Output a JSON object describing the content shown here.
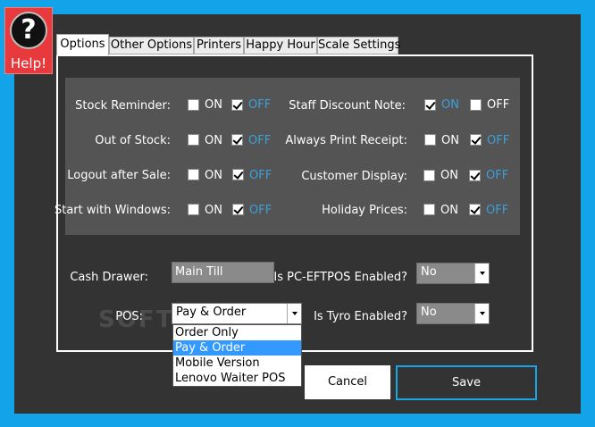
{
  "help": {
    "icon_glyph": "?",
    "label": "Help!"
  },
  "tabs": [
    {
      "label": "Options",
      "active": true
    },
    {
      "label": "Other Options"
    },
    {
      "label": "Printers"
    },
    {
      "label": "Happy Hour"
    },
    {
      "label": "Scale Settings"
    }
  ],
  "options_left": [
    {
      "label": "Stock Reminder:",
      "on": "ON",
      "off": "OFF",
      "checked": "off"
    },
    {
      "label": "Out of Stock:",
      "on": "ON",
      "off": "OFF",
      "checked": "off"
    },
    {
      "label": "Logout after Sale:",
      "on": "ON",
      "off": "OFF",
      "checked": "off"
    },
    {
      "label": "Start with Windows:",
      "on": "ON",
      "off": "OFF",
      "checked": "off"
    }
  ],
  "options_right": [
    {
      "label": "Staff Discount Note:",
      "on": "ON",
      "off": "OFF",
      "checked": "on"
    },
    {
      "label": "Always Print Receipt:",
      "on": "ON",
      "off": "OFF",
      "checked": "off"
    },
    {
      "label": "Customer Display:",
      "on": "ON",
      "off": "OFF",
      "checked": "off"
    },
    {
      "label": "Holiday Prices:",
      "on": "ON",
      "off": "OFF",
      "checked": "off"
    }
  ],
  "cash_drawer": {
    "label": "Cash Drawer:",
    "value": "Main Till"
  },
  "pos": {
    "label": "POS:",
    "value": "Pay & Order",
    "options": [
      "Order Only",
      "Pay & Order",
      "Mobile Version",
      "Lenovo Waiter POS"
    ],
    "selected_index": 1
  },
  "pc_eftpos": {
    "label": "Is PC-EFTPOS Enabled?",
    "value": "No"
  },
  "tyro": {
    "label": "Is Tyro Enabled?",
    "value": "No"
  },
  "watermark": "SOFTPEDIA",
  "buttons": {
    "cancel": "Cancel",
    "save": "Save"
  },
  "colors": {
    "background": "#13A3E8",
    "panel": "#333333",
    "group": "#545454",
    "accent_blue": "#3b9fd8",
    "help_red": "#E8393C"
  }
}
